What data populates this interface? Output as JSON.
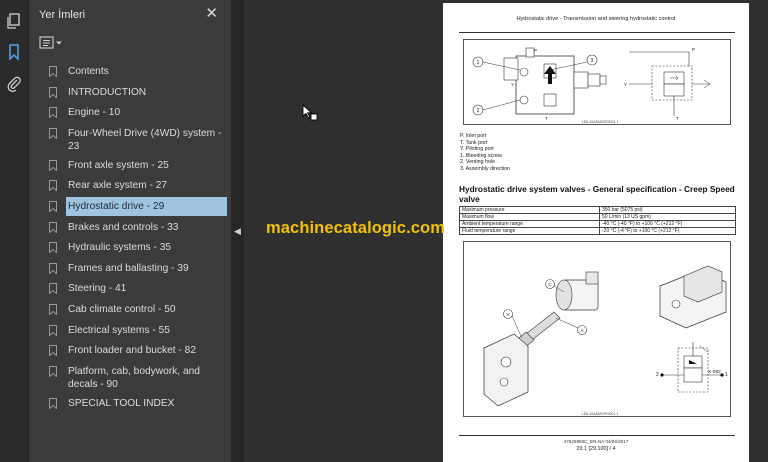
{
  "sidebar": {
    "title": "Yer İmleri",
    "items": [
      {
        "label": "Contents",
        "active": false
      },
      {
        "label": "INTRODUCTION",
        "active": false
      },
      {
        "label": "Engine - 10",
        "active": false
      },
      {
        "label": "Four-Wheel Drive (4WD) system - 23",
        "active": false
      },
      {
        "label": "Front axle system - 25",
        "active": false
      },
      {
        "label": "Rear axle system - 27",
        "active": false
      },
      {
        "label": "Hydrostatic drive - 29",
        "active": true
      },
      {
        "label": "Brakes and controls - 33",
        "active": false
      },
      {
        "label": "Hydraulic systems - 35",
        "active": false
      },
      {
        "label": "Frames and ballasting - 39",
        "active": false
      },
      {
        "label": "Steering - 41",
        "active": false
      },
      {
        "label": "Cab climate control - 50",
        "active": false
      },
      {
        "label": "Electrical systems - 55",
        "active": false
      },
      {
        "label": "Front loader and bucket - 82",
        "active": false
      },
      {
        "label": "Platform, cab, bodywork, and decals - 90",
        "active": false
      },
      {
        "label": "SPECIAL TOOL INDEX",
        "active": false
      }
    ]
  },
  "viewer": {
    "watermark": "machinecatalogic.com"
  },
  "page": {
    "header": "Hydrostatic drive - Transmission and steering hydrostatic control",
    "figure1_caption": "LEIL16ASM23F0001   1",
    "figure1_labels": {
      "c1": "1",
      "c2": "2",
      "c3": "3",
      "p": "P",
      "t": "T",
      "y": "Y",
      "y2": "Y",
      "t2": "T",
      "p2": "P"
    },
    "legend": [
      "P. Inlet port",
      "T. Tank port",
      "Y. Piloting port",
      "1. Bleeding screw",
      "2. Venting hole",
      "3. Assembly direction"
    ],
    "section_title": "Hydrostatic drive system valves - General specification - Creep Speed valve",
    "spec_table": [
      {
        "k": "Maximum pressure",
        "v": "350 bar (5075 psi)"
      },
      {
        "k": "Maximum flow",
        "v": "50 L/min (13 US gpm)"
      },
      {
        "k": "Ambient temperature range",
        "v": "-40 °C (-40 °F) to +100 °C (+212 °F)"
      },
      {
        "k": "Fluid temperature range",
        "v": "-20 °C (-4 °F) to +100 °C (+212 °F)"
      }
    ],
    "figure2_caption": "LEIL16ASM23F0001   1",
    "figure2_labels": {
      "c": "C",
      "v": "V",
      "a": "A",
      "n2": "2",
      "n1": "1",
      "x": "X-082"
    },
    "footer_doc": "47626850C_EN-NA 04/04/2017",
    "footer_page": "29.1 [29.100] / 4"
  },
  "colors": {
    "active_bookmark": "#9ec4df",
    "watermark": "#f2c200",
    "panel_bg": "#3b3b3b",
    "viewer_bg": "#2f2f2f"
  },
  "icons": [
    "pages-icon",
    "bookmark-icon",
    "attachment-icon",
    "close-icon",
    "options-icon",
    "bookmark-ribbon-icon",
    "collapse-arrow-icon",
    "cursor-icon"
  ]
}
